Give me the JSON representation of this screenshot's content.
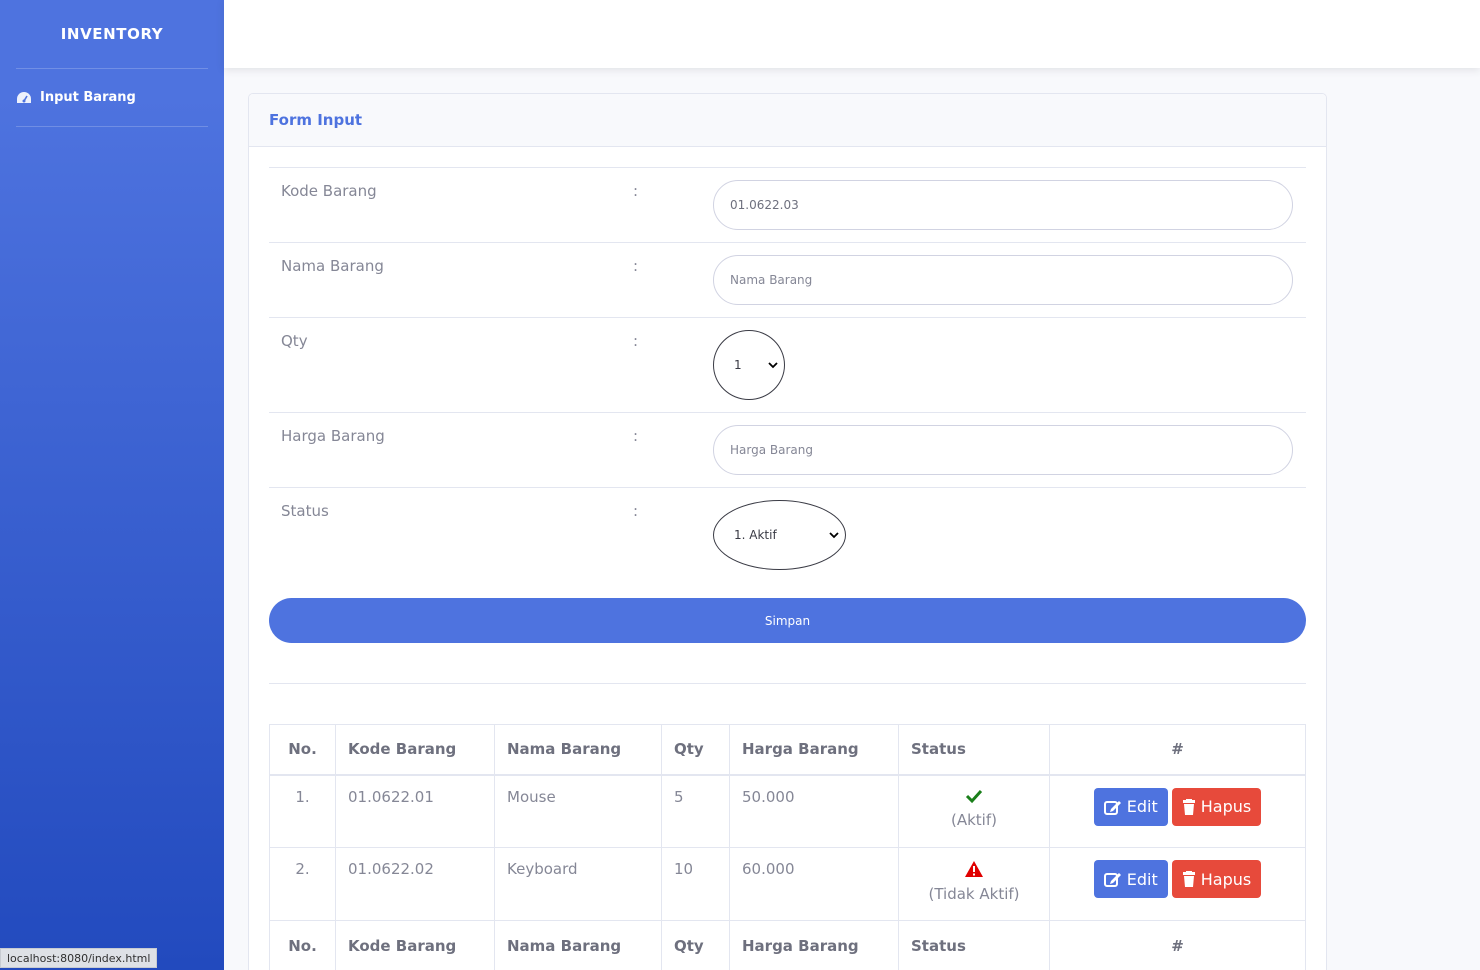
{
  "sidebar": {
    "brand": "INVENTORY",
    "items": [
      {
        "label": "Input Barang",
        "icon": "tachometer-icon"
      }
    ]
  },
  "card": {
    "title": "Form Input"
  },
  "form": {
    "fields": [
      {
        "label": "Kode Barang",
        "separator": ":",
        "value": "01.0622.03",
        "placeholder": ""
      },
      {
        "label": "Nama Barang",
        "separator": ":",
        "value": "",
        "placeholder": "Nama Barang"
      },
      {
        "label": "Qty",
        "separator": ":",
        "selected": "1"
      },
      {
        "label": "Harga Barang",
        "separator": ":",
        "value": "",
        "placeholder": "Harga Barang"
      },
      {
        "label": "Status",
        "separator": ":",
        "selected": "1. Aktif"
      }
    ],
    "submit_label": "Simpan"
  },
  "table": {
    "headers": [
      "No.",
      "Kode Barang",
      "Nama Barang",
      "Qty",
      "Harga Barang",
      "Status",
      "#"
    ],
    "rows": [
      {
        "no": "1.",
        "kode": "01.0622.01",
        "nama": "Mouse",
        "qty": "5",
        "harga": "50.000",
        "status": "(Aktif)",
        "status_icon": "check-icon",
        "status_color": "#1a7f1a"
      },
      {
        "no": "2.",
        "kode": "01.0622.02",
        "nama": "Keyboard",
        "qty": "10",
        "harga": "60.000",
        "status": "(Tidak Aktif)",
        "status_icon": "warning-icon",
        "status_color": "#e00000"
      }
    ],
    "edit_label": "Edit",
    "delete_label": "Hapus"
  },
  "statusbar": {
    "url": "localhost:8080/index.html"
  },
  "colors": {
    "primary": "#4e73df",
    "danger": "#e74a3b",
    "text": "#858796"
  }
}
